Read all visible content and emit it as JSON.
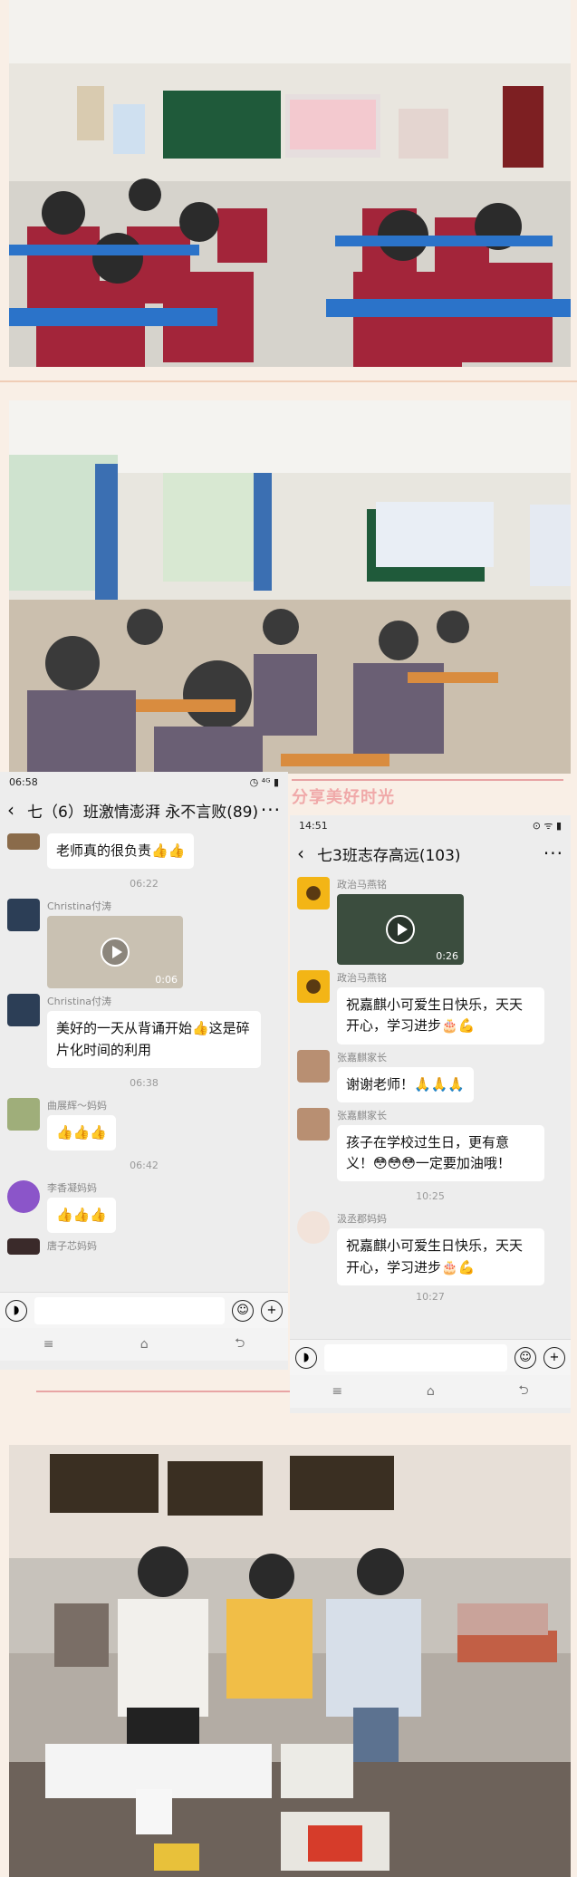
{
  "banner": {
    "share_title": "分享美好时光"
  },
  "left_chat": {
    "status_time": "06:58",
    "status_icons": "◷ ⁴ᴳ ▮",
    "title": "七（6）班激情澎湃 永不言败(89)",
    "more": "···",
    "messages": [
      {
        "type": "text",
        "sender": "",
        "text": "老师真的很负责👍👍"
      },
      {
        "type": "time",
        "text": "06:22"
      },
      {
        "type": "video",
        "sender": "Christina付涛",
        "duration": "0:06"
      },
      {
        "type": "text",
        "sender": "Christina付涛",
        "text": "美好的一天从背诵开始👍这是碎片化时间的利用"
      },
      {
        "type": "time",
        "text": "06:38"
      },
      {
        "type": "text",
        "sender": "曲展辉～妈妈",
        "text": "👍👍👍"
      },
      {
        "type": "time",
        "text": "06:42"
      },
      {
        "type": "text",
        "sender": "李香凝妈妈",
        "text": "👍👍👍"
      },
      {
        "type": "text",
        "sender": "唐子芯妈妈",
        "text": ""
      }
    ],
    "nav": [
      "≡",
      "⌂",
      "⮌"
    ]
  },
  "right_chat": {
    "status_time": "14:51",
    "status_icons": "⊙ ᯤ ▮",
    "title": "七3班志存高远(103)",
    "more": "···",
    "messages": [
      {
        "type": "video",
        "sender": "政治马燕铭",
        "duration": "0:26"
      },
      {
        "type": "text",
        "sender": "政治马燕铭",
        "text": "祝嘉麒小可爱生日快乐，天天开心，学习进步🎂💪"
      },
      {
        "type": "text",
        "sender": "张嘉麒家长",
        "text": "谢谢老师！🙏🙏🙏"
      },
      {
        "type": "text",
        "sender": "张嘉麒家长",
        "text": "孩子在学校过生日，更有意义！😳😳😳一定要加油哦！"
      },
      {
        "type": "time",
        "text": "10:25"
      },
      {
        "type": "text",
        "sender": "汲丞郡妈妈",
        "text": "祝嘉麒小可爱生日快乐，天天开心，学习进步🎂💪"
      },
      {
        "type": "time",
        "text": "10:27"
      }
    ],
    "nav": [
      "≡",
      "⌂",
      "⮌"
    ]
  },
  "colors": {
    "uniform_red": "#a3253a",
    "desk_blue": "#2b73c9",
    "chat_bg": "#ededed",
    "bubble": "#ffffff"
  }
}
